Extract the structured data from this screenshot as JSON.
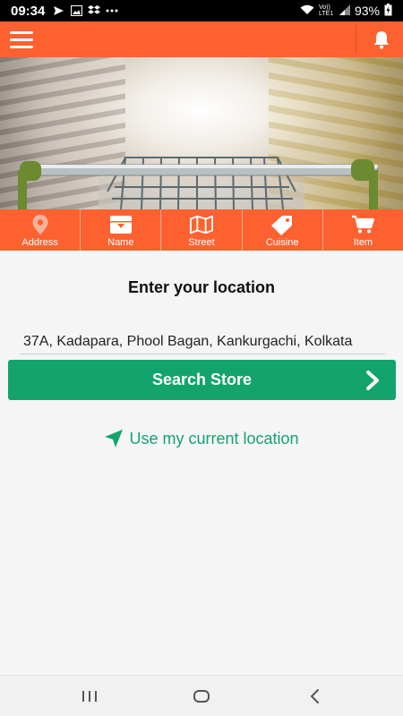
{
  "status": {
    "time": "09:34",
    "battery": "93%",
    "network": "Vo)) LTE1"
  },
  "app_bar": {
    "menu_icon": "hamburger-icon",
    "bell_icon": "bell-icon",
    "color": "#fe6130"
  },
  "categories": [
    {
      "label": "Address",
      "icon": "map-pin-icon"
    },
    {
      "label": "Name",
      "icon": "inbox-download-icon"
    },
    {
      "label": "Street",
      "icon": "map-icon"
    },
    {
      "label": "Cuisine",
      "icon": "tag-icon"
    },
    {
      "label": "Item",
      "icon": "cart-icon"
    }
  ],
  "main": {
    "title": "Enter your location",
    "location_value": "37A, Kadapara, Phool Bagan, Kankurgachi, Kolkata",
    "search_label": "Search Store",
    "use_location_label": "Use my current location",
    "accent": "#12a46c"
  }
}
